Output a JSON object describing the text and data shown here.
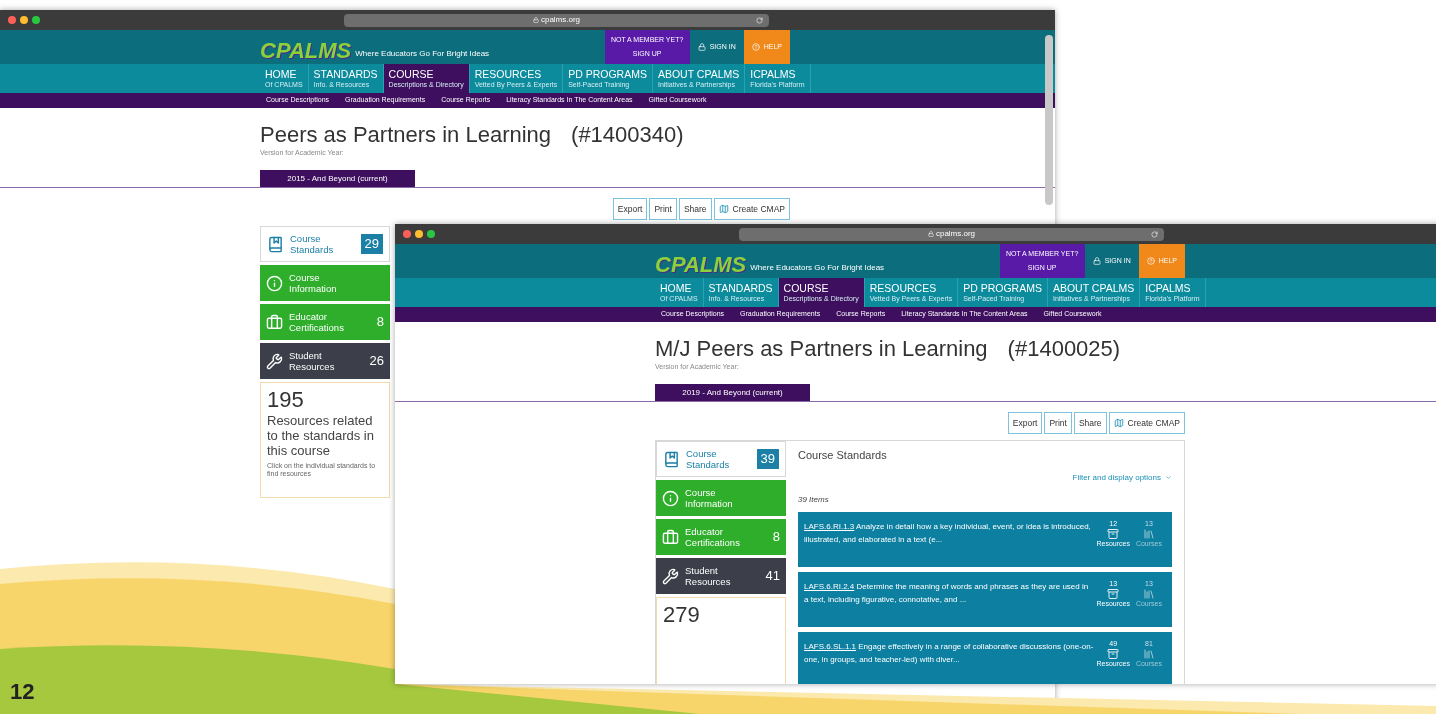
{
  "slide": {
    "page_number": "12"
  },
  "windows": [
    {
      "url": "cpalms.org",
      "logo": "CPALMS",
      "tagline": "Where Educators Go For Bright Ideas",
      "member": {
        "line1": "NOT A MEMBER YET?",
        "line2": "SIGN UP"
      },
      "sign_in": "SIGN IN",
      "help": "HELP",
      "nav": [
        {
          "label": "HOME",
          "sub": "Of CPALMS",
          "selected": false
        },
        {
          "label": "STANDARDS",
          "sub": "Info. & Resources",
          "selected": false
        },
        {
          "label": "COURSE",
          "sub": "Descriptions & Directory",
          "selected": true
        },
        {
          "label": "RESOURCES",
          "sub": "Vetted By Peers & Experts",
          "selected": false
        },
        {
          "label": "PD PROGRAMS",
          "sub": "Self-Paced Training",
          "selected": false
        },
        {
          "label": "ABOUT CPALMS",
          "sub": "Initiatives & Partnerships",
          "selected": false
        },
        {
          "label": "ICPALMS",
          "sub": "Florida's Platform",
          "selected": false
        }
      ],
      "subnav": [
        "Course Descriptions",
        "Graduation Requirements",
        "Course Reports",
        "Literacy Standards In The Content Areas",
        "Gifted Coursework"
      ],
      "title": "Peers as Partners in Learning",
      "course_number": "(#1400340)",
      "version_label": "Version for Academic Year:",
      "version_tab": "2015 - And Beyond (current)",
      "actions": [
        "Export",
        "Print",
        "Share",
        "Create CMAP"
      ],
      "sidebar": [
        {
          "kind": "standards",
          "label": "Course Standards",
          "count": "29"
        },
        {
          "kind": "info",
          "label": "Course Information"
        },
        {
          "kind": "certifications",
          "label": "Educator Certifications",
          "count": "8"
        },
        {
          "kind": "resources",
          "label": "Student Resources",
          "count": "26"
        }
      ],
      "summary": {
        "count": "195",
        "text": "Resources related to the standards in this course",
        "note": "Click on the individual standards to find resources"
      }
    },
    {
      "url": "cpalms.org",
      "logo": "CPALMS",
      "tagline": "Where Educators Go For Bright Ideas",
      "member": {
        "line1": "NOT A MEMBER YET?",
        "line2": "SIGN UP"
      },
      "sign_in": "SIGN IN",
      "help": "HELP",
      "nav": [
        {
          "label": "HOME",
          "sub": "Of CPALMS",
          "selected": false
        },
        {
          "label": "STANDARDS",
          "sub": "Info. & Resources",
          "selected": false
        },
        {
          "label": "COURSE",
          "sub": "Descriptions & Directory",
          "selected": true
        },
        {
          "label": "RESOURCES",
          "sub": "Vetted By Peers & Experts",
          "selected": false
        },
        {
          "label": "PD PROGRAMS",
          "sub": "Self-Paced Training",
          "selected": false
        },
        {
          "label": "ABOUT CPALMS",
          "sub": "Initiatives & Partnerships",
          "selected": false
        },
        {
          "label": "ICPALMS",
          "sub": "Florida's Platform",
          "selected": false
        }
      ],
      "subnav": [
        "Course Descriptions",
        "Graduation Requirements",
        "Course Reports",
        "Literacy Standards In The Content Areas",
        "Gifted Coursework"
      ],
      "title": "M/J Peers as Partners in Learning",
      "course_number": "(#1400025)",
      "version_label": "Version for Academic Year:",
      "version_tab": "2019 - And Beyond (current)",
      "actions": [
        "Export",
        "Print",
        "Share",
        "Create CMAP"
      ],
      "sidebar": [
        {
          "kind": "standards",
          "label": "Course Standards",
          "count": "39"
        },
        {
          "kind": "info",
          "label": "Course Information"
        },
        {
          "kind": "certifications",
          "label": "Educator Certifications",
          "count": "8"
        },
        {
          "kind": "resources",
          "label": "Student Resources",
          "count": "41"
        }
      ],
      "summary": {
        "count": "279"
      },
      "standards_panel": {
        "title": "Course Standards",
        "filter": "Filter and display options",
        "count_text": "39 Items",
        "rows": [
          {
            "code": "LAFS.6.RI.1.3",
            "text": "Analyze in detail how a key individual, event, or idea is introduced, illustrated, and elaborated in a text (e...",
            "resources": "12",
            "resources_label": "Resources",
            "courses": "13",
            "courses_label": "Courses"
          },
          {
            "code": "LAFS.6.RI.2.4",
            "text": "Determine the meaning of words and phrases as they are used in a text, including figurative, connotative, and ...",
            "resources": "13",
            "resources_label": "Resources",
            "courses": "13",
            "courses_label": "Courses"
          },
          {
            "code": "LAFS.6.SL.1.1",
            "text": "Engage effectively in a range of collaborative discussions (one-on-one, in groups, and teacher-led) with diver...",
            "resources": "49",
            "resources_label": "Resources",
            "courses": "81",
            "courses_label": "Courses"
          }
        ]
      }
    }
  ]
}
